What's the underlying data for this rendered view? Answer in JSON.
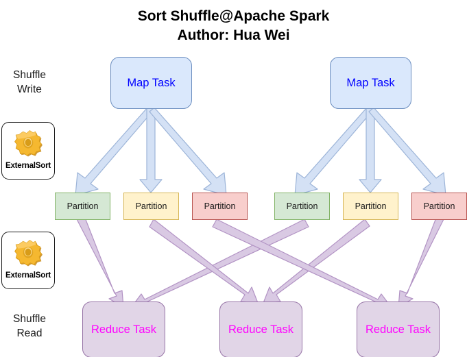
{
  "diagram": {
    "title_line1": "Sort Shuffle@Apache Spark",
    "title_line2": "Author: Hua Wei",
    "colors": {
      "map_fill": "#dae8fc",
      "map_stroke": "#6c8ebf",
      "map_text": "#0000ff",
      "partition_green_fill": "#d5e8d4",
      "partition_green_stroke": "#82b366",
      "partition_yellow_fill": "#fff2cc",
      "partition_yellow_stroke": "#d6b656",
      "partition_red_fill": "#f8cecc",
      "partition_red_stroke": "#b85450",
      "reduce_fill": "#e1d5e7",
      "reduce_stroke": "#9673a6",
      "reduce_text": "#ff00ff",
      "blue_arrow_fill": "#d4e1f5",
      "blue_arrow_stroke": "#9cb4d8",
      "purple_arrow_fill": "#d9c9e3",
      "purple_arrow_stroke": "#b293c4",
      "gear_icon": "#f0b429"
    }
  },
  "stages": [
    {
      "label_line1": "Shuffle",
      "label_line2": "Write",
      "name": "shuffle-write"
    },
    {
      "label_line1": "Shuffle",
      "label_line2": "Read",
      "name": "shuffle-read"
    }
  ],
  "sort_boxes": [
    {
      "label": "ExternalSort",
      "icon": "gear-icon"
    },
    {
      "label": "ExternalSort",
      "icon": "gear-icon"
    }
  ],
  "map_tasks": [
    {
      "label": "Map Task"
    },
    {
      "label": "Map Task"
    }
  ],
  "partitions": [
    {
      "label": "Partition",
      "color": "green"
    },
    {
      "label": "Partition",
      "color": "yellow"
    },
    {
      "label": "Partition",
      "color": "red"
    },
    {
      "label": "Partition",
      "color": "green"
    },
    {
      "label": "Partition",
      "color": "yellow"
    },
    {
      "label": "Partition",
      "color": "red"
    }
  ],
  "reduce_tasks": [
    {
      "label": "Reduce Task"
    },
    {
      "label": "Reduce Task"
    },
    {
      "label": "Reduce Task"
    }
  ]
}
